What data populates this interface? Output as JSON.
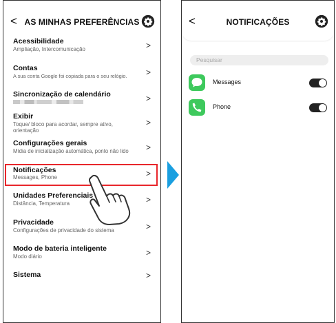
{
  "left_screen": {
    "title": "AS MINHAS PREFERÊNCIAS",
    "back": "<",
    "menu_items": [
      {
        "title": "Acessibilidade",
        "subtitle": "Ampliação, Intercomunicação",
        "chevron": ">"
      },
      {
        "title": "Contas",
        "subtitle": "A sua conta Google foi copiada para o seu relógio.",
        "chevron": ">"
      },
      {
        "title": "Sincronização de calendário",
        "subtitle": "",
        "chevron": ">"
      },
      {
        "title": "Exibir",
        "subtitle": "Toque/ bloco para acordar, sempre ativo,",
        "subtitle2": "orientação",
        "chevron": ">"
      },
      {
        "title": "Configurações gerais",
        "subtitle": "Mídia de inicialização automática, ponto não lido",
        "chevron": ">"
      },
      {
        "title": "Notificações",
        "subtitle": "Messages, Phone",
        "chevron": ">"
      },
      {
        "title": "Unidades Preferenciais",
        "subtitle": "Distância, Temperatura",
        "chevron": ">"
      },
      {
        "title": "Privacidade",
        "subtitle": "Configurações de privacidade do sistema",
        "chevron": ">"
      },
      {
        "title": "Modo de bateria inteligente",
        "subtitle": "Modo diário",
        "chevron": ">"
      },
      {
        "title": "Sistema",
        "subtitle": "",
        "chevron": ">"
      }
    ],
    "highlight_color": "#e8262b"
  },
  "right_screen": {
    "title": "NOTIFICAÇÕES",
    "back": "<",
    "search_placeholder": "Pesquisar",
    "apps": [
      {
        "name": "Messages",
        "icon": "messages-icon",
        "enabled": true
      },
      {
        "name": "Phone",
        "icon": "phone-icon",
        "enabled": true
      }
    ]
  },
  "colors": {
    "arrow": "#1a9fe0",
    "app_icon": "#3ec95d",
    "toggle_on": "#222222"
  }
}
